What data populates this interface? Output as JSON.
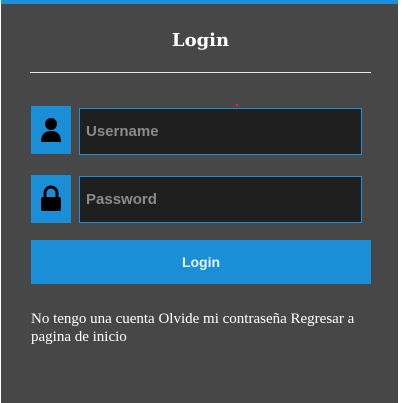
{
  "title": "Login",
  "username": {
    "placeholder": "Username",
    "icon": "user-icon"
  },
  "password": {
    "placeholder": "Password",
    "icon": "lock-icon"
  },
  "login_button": {
    "label": "Login"
  },
  "links": {
    "no_account": "No tengo una cuenta",
    "forgot_password": "Olvide mi contraseña",
    "back_home": "Regresar a pagina de inicio"
  },
  "colors": {
    "panel_bg": "#474747",
    "accent": "#1a8fd8",
    "input_bg": "#1f1f1f",
    "text": "#ffffff"
  }
}
